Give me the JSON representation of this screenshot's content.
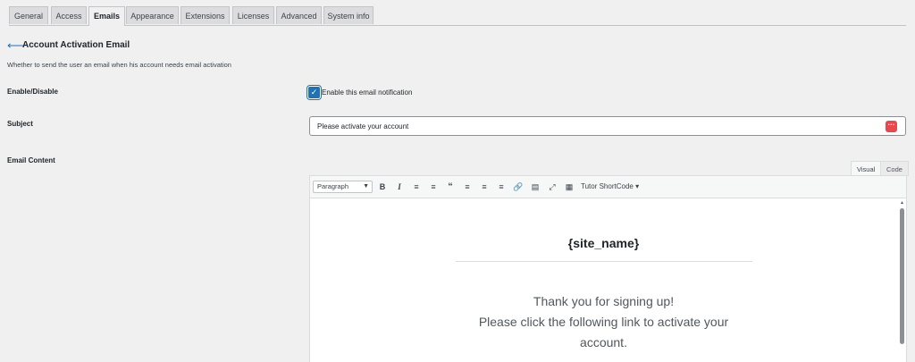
{
  "tabs": [
    {
      "label": "General",
      "active": false
    },
    {
      "label": "Access",
      "active": false
    },
    {
      "label": "Emails",
      "active": true
    },
    {
      "label": "Appearance",
      "active": false
    },
    {
      "label": "Extensions",
      "active": false
    },
    {
      "label": "Licenses",
      "active": false
    },
    {
      "label": "Advanced",
      "active": false
    },
    {
      "label": "System info",
      "active": false
    }
  ],
  "header": {
    "back_icon": "left-arrow-icon",
    "title": "Account Activation Email",
    "description": "Whether to send the user an email when his account needs email activation"
  },
  "settings": {
    "enable_label": "Enable/Disable",
    "enable_checkbox_label": "Enable this email notification",
    "enable_checked": true,
    "subject_label": "Subject",
    "subject_value": "Please activate your account",
    "content_label": "Email Content"
  },
  "editor": {
    "tab_visual": "Visual",
    "tab_code": "Code",
    "format_select": "Paragraph",
    "shortcode_menu": "Tutor ShortCode ▾",
    "toolbar_icons": [
      "bold-icon",
      "italic-icon",
      "bullet-list-icon",
      "numbered-list-icon",
      "blockquote-icon",
      "align-left-icon",
      "align-center-icon",
      "align-right-icon",
      "link-icon",
      "read-more-icon",
      "fullscreen-icon",
      "toolbar-toggle-icon"
    ],
    "body_title": "{site_name}",
    "body_line1": "Thank you for signing up!",
    "body_line2": "Please click the following link to activate your",
    "body_line3": "account."
  },
  "colors": {
    "accent": "#2271b1",
    "danger_badge": "#e5484d",
    "background": "#f0f0f1"
  }
}
